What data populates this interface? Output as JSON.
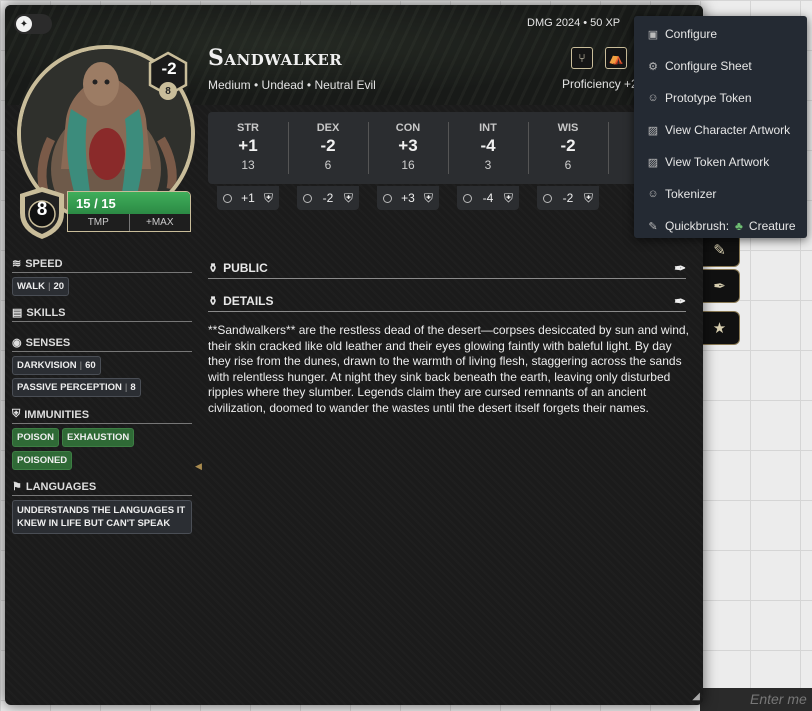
{
  "background": {
    "chat_placeholder": "Enter me"
  },
  "side_buttons": [
    {
      "icon": "pencil-icon"
    },
    {
      "icon": "feather-icon"
    },
    {
      "icon": "star-icon"
    }
  ],
  "sheet": {
    "source": "DMG 2024 • 50 XP",
    "name": "Sandwalker",
    "subtitle": "Medium • Undead • Neutral Evil",
    "proficiency": "Proficiency +2",
    "challenge": {
      "value": "-2",
      "badge": "8"
    },
    "armor_class": "8",
    "hp": {
      "text": "15 / 15",
      "fraction": 1.0,
      "temp_label": "TMP",
      "max_label": "+MAX"
    },
    "header_buttons": [
      {
        "icon": "utensils-icon"
      },
      {
        "icon": "campfire-icon"
      }
    ],
    "abilities": [
      {
        "label": "STR",
        "mod": "+1",
        "score": "13",
        "save": "+1"
      },
      {
        "label": "DEX",
        "mod": "-2",
        "score": "6",
        "save": "-2"
      },
      {
        "label": "CON",
        "mod": "+3",
        "score": "16",
        "save": "+3"
      },
      {
        "label": "INT",
        "mod": "-4",
        "score": "3",
        "save": "-4"
      },
      {
        "label": "WIS",
        "mod": "-2",
        "score": "6",
        "save": "-2"
      },
      {
        "label": "",
        "mod": "",
        "score": "",
        "save": ""
      }
    ],
    "sidebar": {
      "speed": {
        "title": "SPEED",
        "items": [
          {
            "name": "WALK",
            "value": "20"
          }
        ]
      },
      "skills": {
        "title": "SKILLS"
      },
      "senses": {
        "title": "SENSES",
        "items": [
          {
            "name": "DARKVISION",
            "value": "60"
          },
          {
            "name": "PASSIVE PERCEPTION",
            "value": "8"
          }
        ]
      },
      "immunities": {
        "title": "IMMUNITIES",
        "items": [
          "POISON",
          "EXHAUSTION",
          "POISONED"
        ]
      },
      "languages": {
        "title": "LANGUAGES",
        "text": "UNDERSTANDS THE LANGUAGES IT KNEW IN LIFE BUT CAN'T SPEAK"
      }
    },
    "sections": {
      "public": "PUBLIC",
      "details": "DETAILS"
    },
    "details_text": "**Sandwalkers** are the restless dead of the desert—corpses desiccated by sun and wind, their skin cracked like old leather and their eyes glowing faintly with baleful light. By day they rise from the dunes, drawn to the warmth of living flesh, staggering across the sands with relentless hunger. At night they sink back beneath the earth, leaving only disturbed ripples where they slumber. Legends claim they are cursed remnants of an ancient civilization, doomed to wander the wastes until the desert itself forgets their names."
  },
  "context_menu": [
    {
      "label": "Configure",
      "icon": "cube-icon"
    },
    {
      "label": "Configure Sheet",
      "icon": "gear-icon"
    },
    {
      "label": "Prototype Token",
      "icon": "user-circle-icon"
    },
    {
      "label": "View Character Artwork",
      "icon": "image-icon"
    },
    {
      "label": "View Token Artwork",
      "icon": "image-icon"
    },
    {
      "label": "Tokenizer",
      "icon": "user-circle-icon"
    },
    {
      "label": "Quickbrush:",
      "icon": "brush-icon",
      "suffix": "Creature"
    }
  ]
}
